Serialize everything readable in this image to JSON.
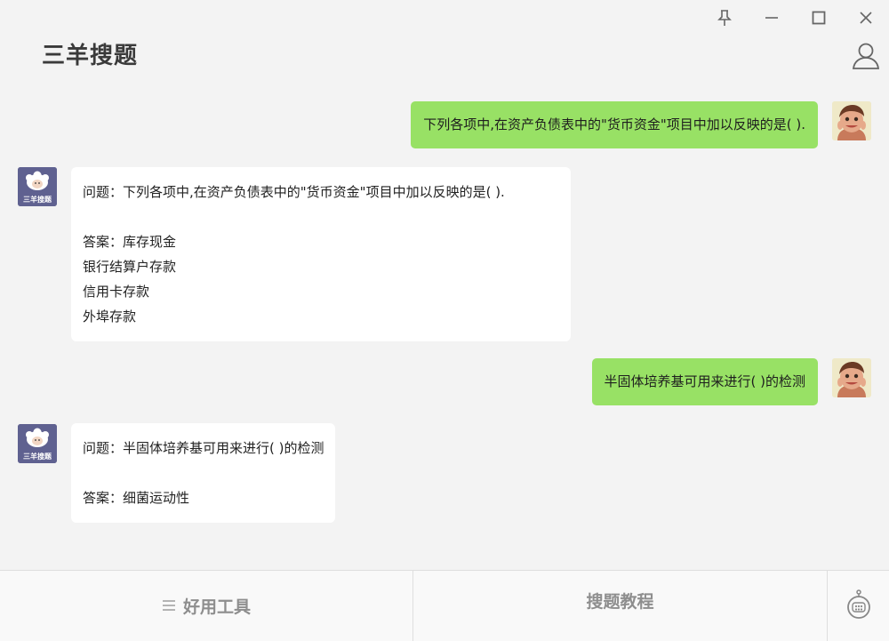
{
  "app": {
    "title": "三羊搜题"
  },
  "messages": [
    {
      "role": "user",
      "text": "下列各项中,在资产负债表中的\"货币资金\"项目中加以反映的是( )."
    },
    {
      "role": "bot",
      "lines": [
        "问题：下列各项中,在资产负债表中的\"货币资金\"项目中加以反映的是( ).",
        "",
        "答案：库存现金",
        "银行结算户存款",
        "信用卡存款",
        "外埠存款"
      ]
    },
    {
      "role": "user",
      "text": "半固体培养基可用来进行( )的检测"
    },
    {
      "role": "bot",
      "lines": [
        "问题：半固体培养基可用来进行( )的检测",
        "",
        "答案：细菌运动性"
      ]
    }
  ],
  "bot_avatar": {
    "label": "三羊搜题"
  },
  "bottom": {
    "tools_label": "好用工具",
    "tutorial_label": "搜题教程"
  },
  "icons": {
    "pin": "pin-icon",
    "minimize": "minimize-icon",
    "maximize": "maximize-icon",
    "close": "close-icon",
    "user": "user-icon",
    "menu": "menu-icon",
    "robot": "robot-icon"
  },
  "colors": {
    "user_bubble": "#98e165",
    "bot_bubble": "#ffffff",
    "background": "#f3f3f3",
    "bot_avatar_bg": "#5f6190"
  }
}
